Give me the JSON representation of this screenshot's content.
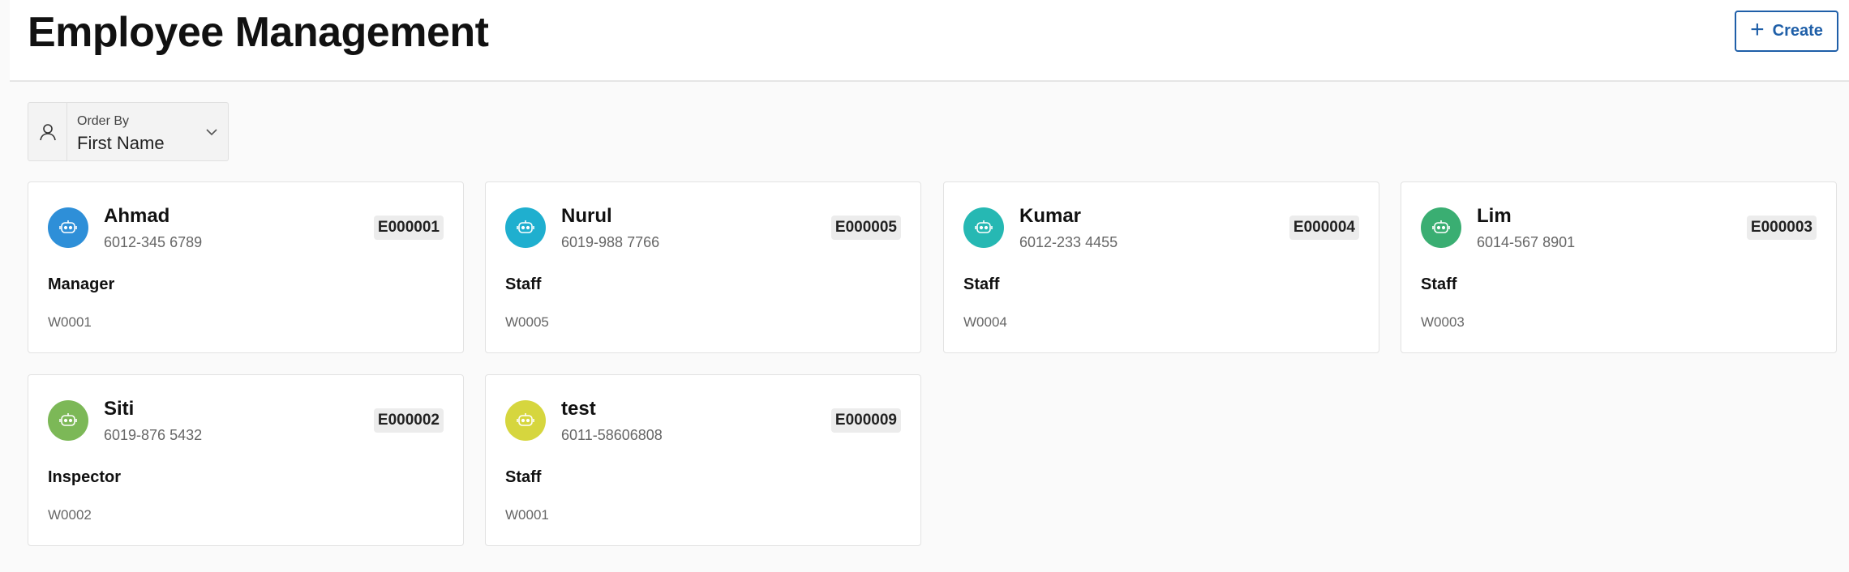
{
  "header": {
    "title": "Employee Management",
    "create_label": "Create"
  },
  "order_by": {
    "label": "Order By",
    "value": "First Name",
    "icon": "person-icon"
  },
  "employees": [
    {
      "name": "Ahmad",
      "phone": "6012-345 6789",
      "code": "E000001",
      "role": "Manager",
      "workstation": "W0001",
      "color": "#2e8fd8"
    },
    {
      "name": "Nurul",
      "phone": "6019-988 7766",
      "code": "E000005",
      "role": "Staff",
      "workstation": "W0005",
      "color": "#1fafcf"
    },
    {
      "name": "Kumar",
      "phone": "6012-233 4455",
      "code": "E000004",
      "role": "Staff",
      "workstation": "W0004",
      "color": "#26b8b3"
    },
    {
      "name": "Lim",
      "phone": "6014-567 8901",
      "code": "E000003",
      "role": "Staff",
      "workstation": "W0003",
      "color": "#3aae72"
    },
    {
      "name": "Siti",
      "phone": "6019-876 5432",
      "code": "E000002",
      "role": "Inspector",
      "workstation": "W0002",
      "color": "#7cb857"
    },
    {
      "name": "test",
      "phone": "6011-58606808",
      "code": "E000009",
      "role": "Staff",
      "workstation": "W0001",
      "color": "#d6d63e"
    }
  ]
}
